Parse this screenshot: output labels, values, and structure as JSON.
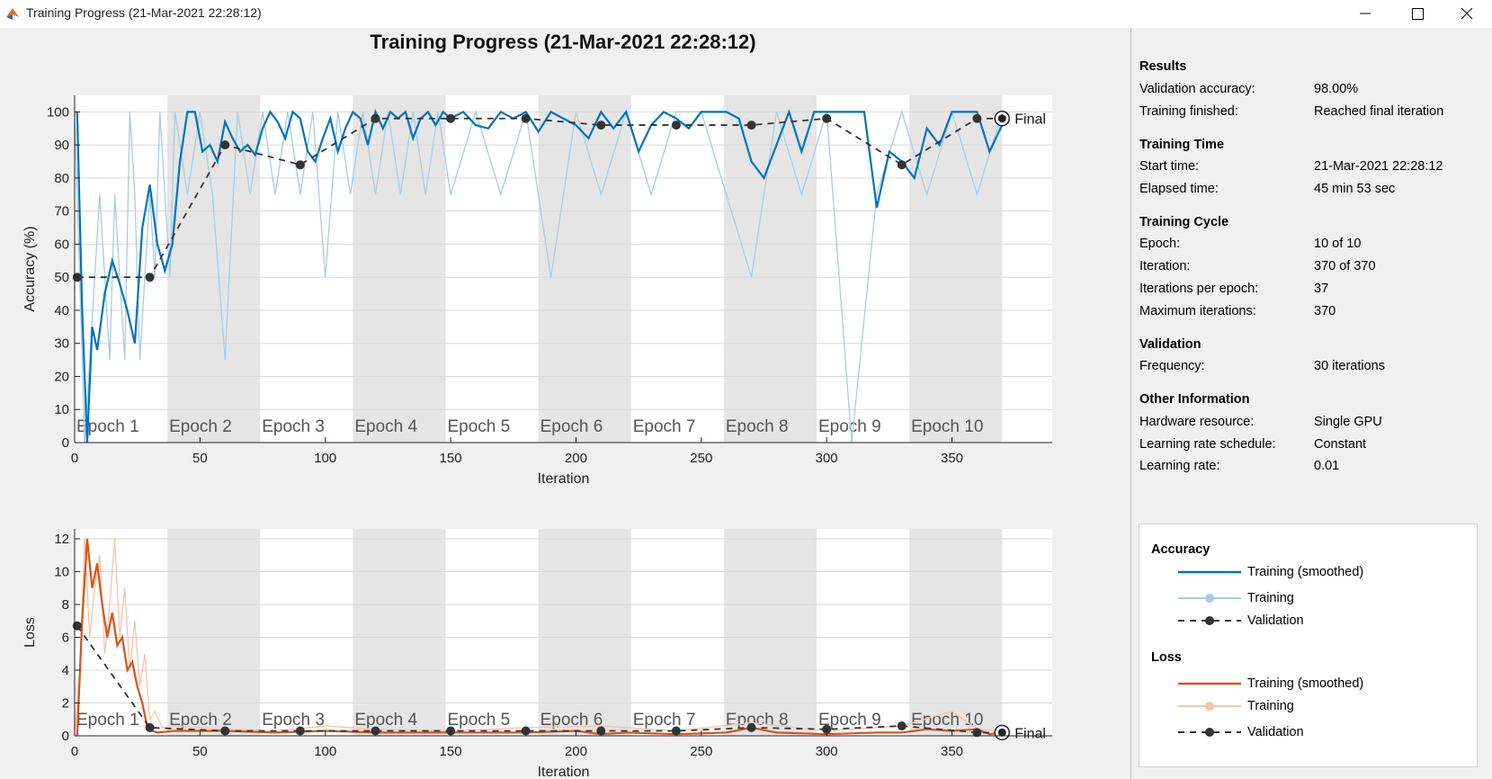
{
  "window": {
    "title": "Training Progress (21-Mar-2021 22:28:12)",
    "controls": [
      "minimize",
      "maximize",
      "close"
    ]
  },
  "figure_title": "Training Progress (21-Mar-2021 22:28:12)",
  "colors": {
    "accuracy_smoothed": "#0072bd",
    "accuracy_raw": "#a6cee3",
    "loss_smoothed": "#d95319",
    "loss_raw": "#f5c4ad",
    "validation": "#333333",
    "epoch_shade": "#e5e5e5"
  },
  "sidebar": {
    "results": {
      "heading": "Results",
      "rows": [
        {
          "label": "Validation accuracy:",
          "value": "98.00%"
        },
        {
          "label": "Training finished:",
          "value": "Reached final iteration"
        }
      ]
    },
    "training_time": {
      "heading": "Training Time",
      "rows": [
        {
          "label": "Start time:",
          "value": "21-Mar-2021 22:28:12"
        },
        {
          "label": "Elapsed time:",
          "value": "45 min 53 sec"
        }
      ]
    },
    "training_cycle": {
      "heading": "Training Cycle",
      "rows": [
        {
          "label": "Epoch:",
          "value": "10 of 10"
        },
        {
          "label": "Iteration:",
          "value": "370 of 370"
        },
        {
          "label": "Iterations per epoch:",
          "value": "37"
        },
        {
          "label": "Maximum iterations:",
          "value": "370"
        }
      ]
    },
    "validation": {
      "heading": "Validation",
      "rows": [
        {
          "label": "Frequency:",
          "value": "30 iterations"
        }
      ]
    },
    "other": {
      "heading": "Other Information",
      "rows": [
        {
          "label": "Hardware resource:",
          "value": "Single GPU"
        },
        {
          "label": "Learning rate schedule:",
          "value": "Constant"
        },
        {
          "label": "Learning rate:",
          "value": "0.01"
        }
      ]
    }
  },
  "legend": {
    "accuracy_heading": "Accuracy",
    "accuracy_items": [
      "Training (smoothed)",
      "Training",
      "Validation"
    ],
    "loss_heading": "Loss",
    "loss_items": [
      "Training (smoothed)",
      "Training",
      "Validation"
    ]
  },
  "chart_data": [
    {
      "type": "line",
      "ylabel": "Accuracy (%)",
      "xlabel": "Iteration",
      "xlim": [
        0,
        390
      ],
      "ylim": [
        0,
        105
      ],
      "xticks": [
        0,
        50,
        100,
        150,
        200,
        250,
        300,
        350
      ],
      "yticks": [
        0,
        10,
        20,
        30,
        40,
        50,
        60,
        70,
        80,
        90,
        100
      ],
      "epochs": [
        "Epoch 1",
        "Epoch 2",
        "Epoch 3",
        "Epoch 4",
        "Epoch 5",
        "Epoch 6",
        "Epoch 7",
        "Epoch 8",
        "Epoch 9",
        "Epoch 10"
      ],
      "iterations_per_epoch": 37,
      "final_label": "Final",
      "final_value": 98,
      "series": [
        {
          "name": "Training (smoothed)",
          "x": [
            1,
            3,
            5,
            7,
            9,
            12,
            15,
            18,
            21,
            24,
            27,
            30,
            33,
            36,
            39,
            42,
            45,
            48,
            51,
            54,
            57,
            60,
            63,
            66,
            69,
            72,
            75,
            78,
            81,
            84,
            87,
            90,
            93,
            96,
            99,
            102,
            105,
            108,
            111,
            114,
            117,
            120,
            123,
            126,
            129,
            132,
            135,
            138,
            141,
            144,
            147,
            150,
            155,
            160,
            165,
            170,
            175,
            180,
            185,
            190,
            195,
            200,
            205,
            210,
            215,
            220,
            225,
            230,
            235,
            240,
            245,
            250,
            255,
            260,
            265,
            270,
            275,
            280,
            285,
            290,
            295,
            300,
            305,
            310,
            315,
            320,
            325,
            330,
            335,
            340,
            345,
            350,
            355,
            360,
            365,
            370
          ],
          "y": [
            100,
            40,
            0,
            35,
            28,
            45,
            55,
            48,
            40,
            30,
            65,
            78,
            60,
            52,
            60,
            85,
            100,
            100,
            88,
            90,
            85,
            97,
            92,
            88,
            90,
            87,
            95,
            100,
            97,
            92,
            100,
            98,
            88,
            85,
            92,
            98,
            88,
            95,
            100,
            98,
            90,
            100,
            95,
            100,
            98,
            100,
            92,
            98,
            100,
            96,
            100,
            98,
            100,
            96,
            95,
            100,
            98,
            100,
            94,
            100,
            98,
            96,
            92,
            100,
            95,
            100,
            88,
            96,
            100,
            98,
            95,
            100,
            100,
            100,
            98,
            85,
            80,
            90,
            100,
            88,
            100,
            100,
            100,
            100,
            100,
            71,
            88,
            85,
            80,
            95,
            90,
            100,
            100,
            100,
            88,
            96
          ]
        },
        {
          "name": "Training",
          "x": [
            0,
            2,
            4,
            6,
            8,
            10,
            12,
            14,
            16,
            18,
            20,
            22,
            24,
            26,
            28,
            30,
            32,
            34,
            36,
            38,
            40,
            45,
            50,
            55,
            60,
            65,
            70,
            75,
            80,
            85,
            90,
            95,
            100,
            105,
            110,
            115,
            120,
            125,
            130,
            135,
            140,
            145,
            150,
            160,
            170,
            180,
            190,
            200,
            210,
            220,
            230,
            240,
            250,
            260,
            270,
            280,
            290,
            300,
            310,
            320,
            330,
            340,
            350,
            360,
            370
          ],
          "y": [
            100,
            50,
            0,
            25,
            50,
            75,
            50,
            25,
            75,
            50,
            25,
            100,
            75,
            25,
            50,
            75,
            50,
            100,
            75,
            50,
            100,
            75,
            100,
            75,
            25,
            100,
            75,
            100,
            75,
            100,
            75,
            100,
            50,
            100,
            75,
            100,
            75,
            100,
            75,
            100,
            75,
            100,
            75,
            100,
            75,
            100,
            50,
            100,
            75,
            100,
            75,
            100,
            100,
            75,
            50,
            100,
            75,
            100,
            0,
            75,
            100,
            75,
            100,
            75,
            100
          ]
        },
        {
          "name": "Validation",
          "x": [
            1,
            30,
            60,
            90,
            120,
            150,
            180,
            210,
            240,
            270,
            300,
            330,
            360,
            370
          ],
          "y": [
            50,
            50,
            90,
            84,
            98,
            98,
            98,
            96,
            96,
            96,
            98,
            84,
            98,
            98
          ]
        }
      ]
    },
    {
      "type": "line",
      "ylabel": "Loss",
      "xlabel": "Iteration",
      "xlim": [
        0,
        390
      ],
      "ylim": [
        0,
        12.6
      ],
      "xticks": [
        0,
        50,
        100,
        150,
        200,
        250,
        300,
        350
      ],
      "yticks": [
        0,
        2,
        4,
        6,
        8,
        10,
        12
      ],
      "epochs": [
        "Epoch 1",
        "Epoch 2",
        "Epoch 3",
        "Epoch 4",
        "Epoch 5",
        "Epoch 6",
        "Epoch 7",
        "Epoch 8",
        "Epoch 9",
        "Epoch 10"
      ],
      "iterations_per_epoch": 37,
      "final_label": "Final",
      "final_value": 0.2,
      "series": [
        {
          "name": "Training (smoothed)",
          "x": [
            1,
            3,
            5,
            7,
            9,
            11,
            13,
            15,
            17,
            19,
            21,
            23,
            25,
            27,
            29,
            31,
            33,
            40,
            60,
            80,
            100,
            120,
            140,
            160,
            180,
            200,
            210,
            220,
            240,
            260,
            270,
            280,
            300,
            320,
            330,
            340,
            350,
            360,
            365,
            370
          ],
          "y": [
            0,
            7,
            12,
            9,
            10.5,
            8,
            6,
            7.5,
            5.5,
            6,
            4,
            4.5,
            3,
            2,
            0.5,
            0.3,
            0.2,
            0.3,
            0.3,
            0.2,
            0.3,
            0.2,
            0.2,
            0.2,
            0.2,
            0.3,
            0.1,
            0.2,
            0.1,
            0.2,
            0.5,
            0.2,
            0.1,
            0.2,
            0.2,
            0.4,
            0.3,
            0.4,
            0.1,
            0.2
          ]
        },
        {
          "name": "Training",
          "x": [
            0,
            2,
            4,
            6,
            8,
            10,
            12,
            14,
            16,
            18,
            20,
            22,
            24,
            26,
            28,
            30,
            32,
            35,
            40,
            60,
            80,
            100,
            120,
            150,
            180,
            210,
            240,
            270,
            300,
            330,
            350,
            360,
            370
          ],
          "y": [
            0,
            4,
            12,
            6,
            9,
            11,
            5,
            8,
            12,
            6,
            9,
            4,
            7,
            3,
            5,
            1,
            1.5,
            0.5,
            0.6,
            0.4,
            0.3,
            0.6,
            0.4,
            0.3,
            0.5,
            0.6,
            0.3,
            0.8,
            0.3,
            0.6,
            1.5,
            0.4,
            0.3
          ]
        },
        {
          "name": "Validation",
          "x": [
            1,
            30,
            60,
            90,
            120,
            150,
            180,
            210,
            240,
            270,
            300,
            330,
            360,
            370
          ],
          "y": [
            6.7,
            0.5,
            0.3,
            0.3,
            0.3,
            0.3,
            0.3,
            0.3,
            0.3,
            0.5,
            0.4,
            0.6,
            0.2,
            0.2
          ]
        }
      ]
    }
  ]
}
